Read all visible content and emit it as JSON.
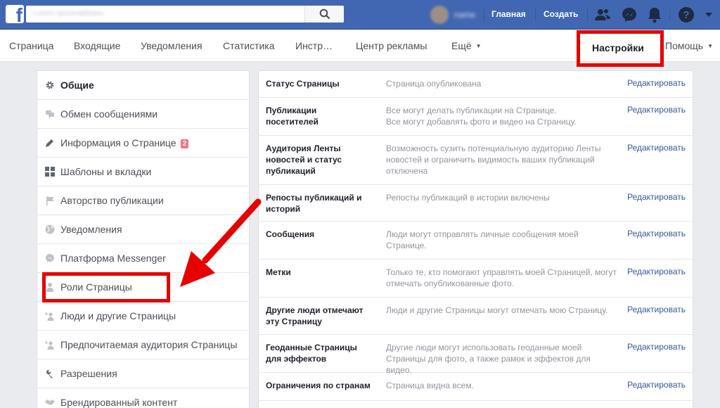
{
  "topbar": {
    "logo": "f",
    "search_placeholder": "Lorem Ipsumabbaso",
    "user_name": "name",
    "home": "Главная",
    "create": "Создать"
  },
  "tabs": {
    "page": "Страница",
    "inbox": "Входящие",
    "notifications": "Уведомления",
    "statistics": "Статистика",
    "tools": "Инстр…",
    "ads_center": "Центр рекламы",
    "more": "Ещё",
    "settings": "Настройки",
    "help": "Помощь"
  },
  "sidebar": {
    "items": [
      {
        "label": "Общие",
        "badge": "",
        "icon": "gear-icon"
      },
      {
        "label": "Обмен сообщениями",
        "badge": "",
        "icon": "chat-icon"
      },
      {
        "label": "Информация о Странице",
        "badge": "2",
        "icon": "pencil-icon"
      },
      {
        "label": "Шаблоны и вкладки",
        "badge": "",
        "icon": "grid-icon"
      },
      {
        "label": "Авторство публикации",
        "badge": "",
        "icon": "flag-icon"
      },
      {
        "label": "Уведомления",
        "badge": "",
        "icon": "globe-icon"
      },
      {
        "label": "Платформа Messenger",
        "badge": "",
        "icon": "messenger-icon"
      },
      {
        "label": "Роли Страницы",
        "badge": "",
        "icon": "person-icon"
      },
      {
        "label": "Люди и другие Страницы",
        "badge": "",
        "icon": "person-add-icon"
      },
      {
        "label": "Предпочитаемая аудитория Страницы",
        "badge": "",
        "icon": "person-add-icon"
      },
      {
        "label": "Разрешения",
        "badge": "",
        "icon": "wrench-icon"
      },
      {
        "label": "Брендированный контент",
        "badge": "",
        "icon": "handshake-icon"
      }
    ]
  },
  "settings": {
    "edit_label": "Редактировать",
    "rows": [
      {
        "name": "Статус Страницы",
        "desc": "Страница опубликована"
      },
      {
        "name": "Публикации посетителей",
        "desc": "Все могут делать публикации на Странице.\nВсе могут добавлять фото и видео на Страницу."
      },
      {
        "name": "Аудитория Ленты новостей и статус публикаций",
        "desc": "Возможность сузить потенциальную аудиторию Ленты новостей и ограничить видимость ваших публикаций отключена"
      },
      {
        "name": "Репосты публикаций и историй",
        "desc": "Репосты публикаций в истории включены"
      },
      {
        "name": "Сообщения",
        "desc": "Люди могут отправлять личные сообщения моей Странице."
      },
      {
        "name": "Метки",
        "desc": "Только те, кто помогают управлять моей Страницей, могут отмечать опубликованные фото."
      },
      {
        "name": "Другие люди отмечают эту Страницу",
        "desc": "Люди и другие Страницы могут отмечать мою Страницу."
      },
      {
        "name": "Геоданные Страницы для эффектов",
        "desc": "Другие люди могут использовать геоданные моей Страницы для фото, а также рамок и эффектов для видео."
      },
      {
        "name": "Ограничения по странам",
        "desc": "Страница видна всем."
      }
    ]
  },
  "colors": {
    "brand_blue": "#4267b2",
    "link": "#365899",
    "highlight_red": "#e60000"
  }
}
